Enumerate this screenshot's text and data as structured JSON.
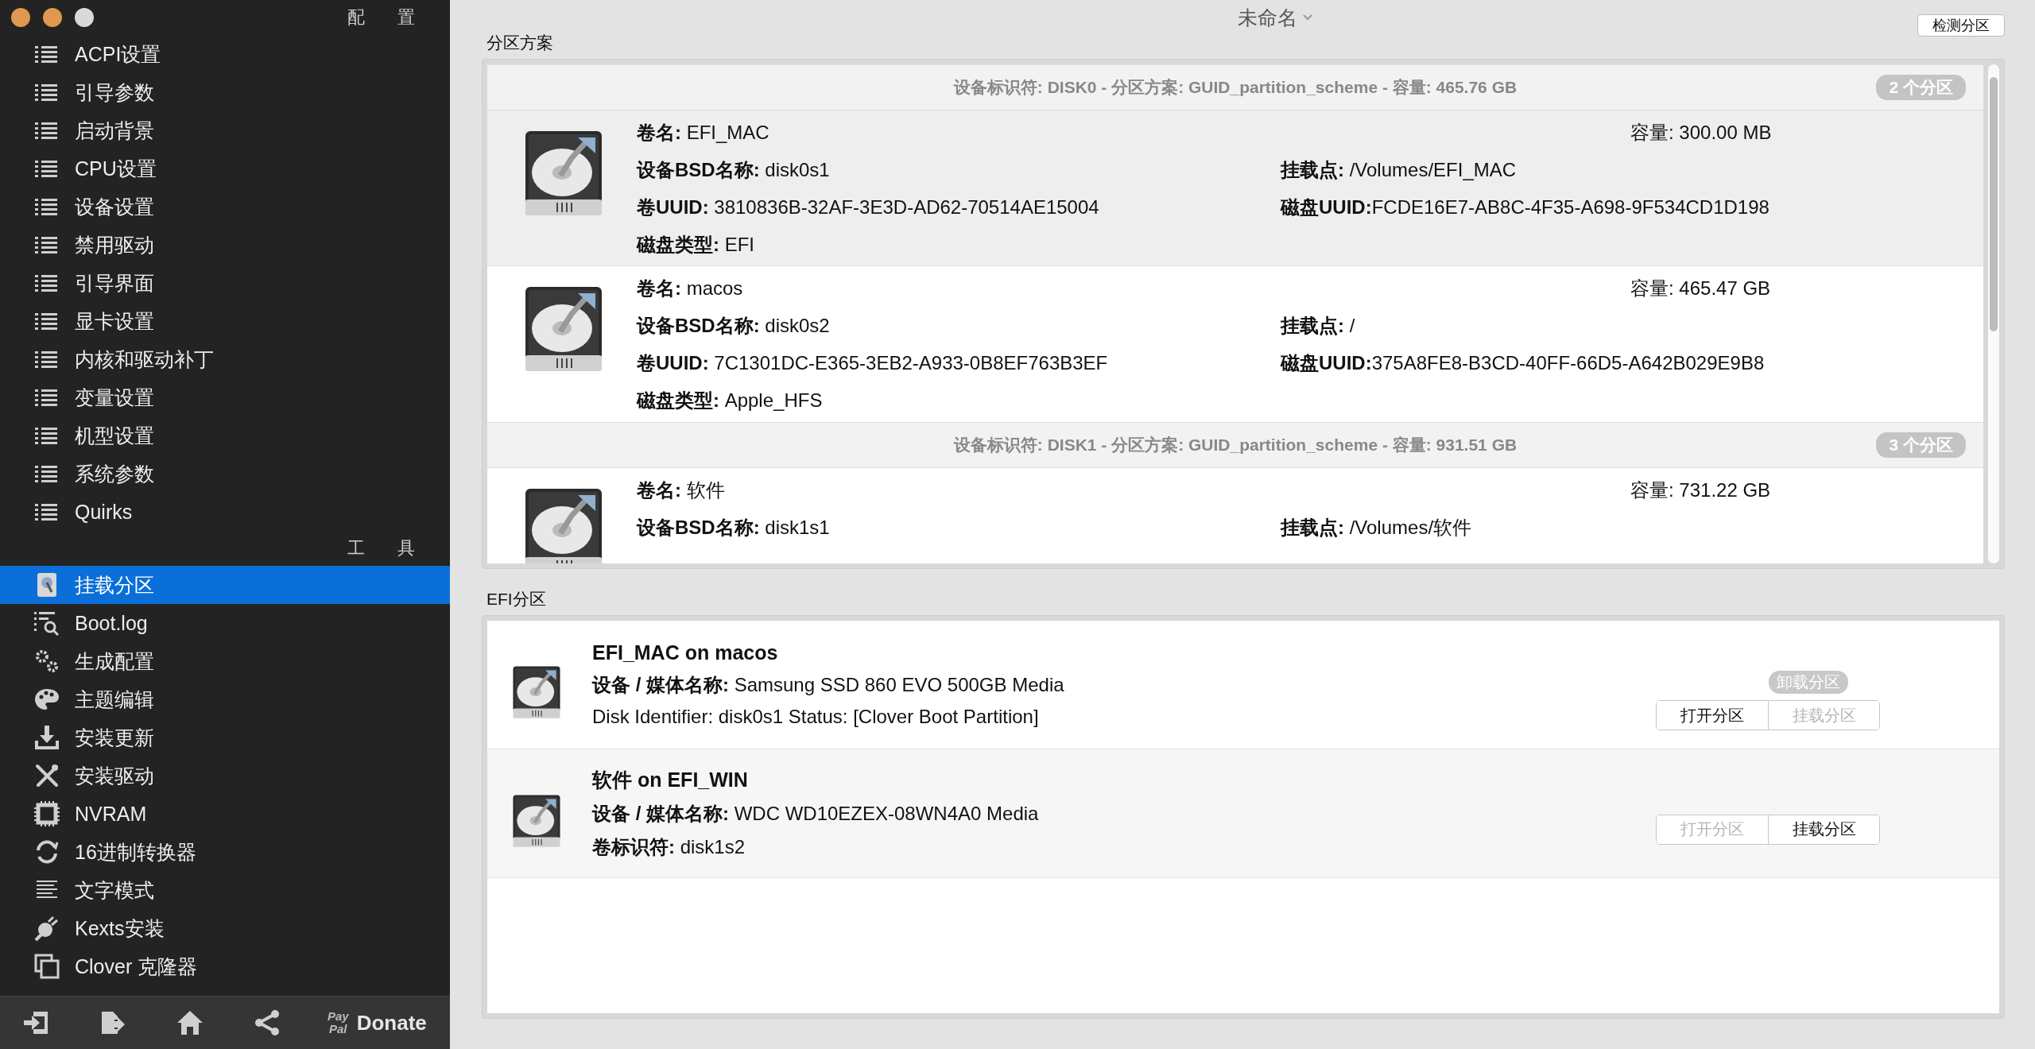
{
  "window": {
    "title": "未命名"
  },
  "sidebar": {
    "sections": [
      {
        "title": "配 置",
        "items": [
          {
            "label": "ACPI设置",
            "selected": false
          },
          {
            "label": "引导参数",
            "selected": false
          },
          {
            "label": "启动背景",
            "selected": false
          },
          {
            "label": "CPU设置",
            "selected": false
          },
          {
            "label": "设备设置",
            "selected": false
          },
          {
            "label": "禁用驱动",
            "selected": false
          },
          {
            "label": "引导界面",
            "selected": false
          },
          {
            "label": "显卡设置",
            "selected": false
          },
          {
            "label": "内核和驱动补丁",
            "selected": false
          },
          {
            "label": "变量设置",
            "selected": false
          },
          {
            "label": "机型设置",
            "selected": false
          },
          {
            "label": "系统参数",
            "selected": false
          },
          {
            "label": "Quirks",
            "selected": false
          }
        ]
      },
      {
        "title": "工 具",
        "items": [
          {
            "label": "挂载分区",
            "selected": true
          },
          {
            "label": "Boot.log",
            "selected": false
          },
          {
            "label": "生成配置",
            "selected": false
          },
          {
            "label": "主题编辑",
            "selected": false
          },
          {
            "label": "安装更新",
            "selected": false
          },
          {
            "label": "安装驱动",
            "selected": false
          },
          {
            "label": "NVRAM",
            "selected": false
          },
          {
            "label": "16进制转换器",
            "selected": false
          },
          {
            "label": "文字模式",
            "selected": false
          },
          {
            "label": "Kexts安装",
            "selected": false
          },
          {
            "label": "Clover 克隆器",
            "selected": false
          }
        ]
      }
    ],
    "footer": {
      "paypal": [
        "Pay",
        "Pal"
      ],
      "donate": "Donate"
    }
  },
  "partition_scheme": {
    "title": "分区方案",
    "detect_button": "检测分区",
    "disks": [
      {
        "header": "设备标识符: DISK0 - 分区方案: GUID_partition_scheme - 容量: 465.76 GB",
        "badge": "2 个分区",
        "partitions": [
          {
            "selected": true,
            "name": "**卷名:** EFI_MAC",
            "capacity": "容量:  300.00 MB",
            "bsd": "**设备BSD名称:** disk0s1",
            "mount": "**挂载点:** /Volumes/EFI_MAC",
            "volume_uuid": "**卷UUID:** 3810836B-32AF-3E3D-AD62-70514AE15004",
            "disk_uuid": "**磁盘UUID:**FCDE16E7-AB8C-4F35-A698-9F534CD1D198",
            "type": "**磁盘类型:** EFI"
          },
          {
            "selected": false,
            "name": "**卷名:** macos",
            "capacity": "容量:  465.47 GB",
            "bsd": "**设备BSD名称:** disk0s2",
            "mount": "**挂载点:** /",
            "volume_uuid": "**卷UUID:** 7C1301DC-E365-3EB2-A933-0B8EF763B3EF",
            "disk_uuid": "**磁盘UUID:**375A8FE8-B3CD-40FF-66D5-A642B029E9B8",
            "type": "**磁盘类型:** Apple_HFS"
          }
        ]
      },
      {
        "header": "设备标识符: DISK1 - 分区方案: GUID_partition_scheme - 容量: 931.51 GB",
        "badge": "3 个分区",
        "partitions": [
          {
            "selected": false,
            "name": "**卷名:** 软件",
            "capacity": "容量:  731.22 GB",
            "bsd": "**设备BSD名称:** disk1s1",
            "mount": "**挂载点:** /Volumes/软件"
          }
        ]
      }
    ]
  },
  "efi": {
    "title": "EFI分区",
    "items": [
      {
        "title": "EFI_MAC on macos",
        "line_1": "**设备 / 媒体名称:** Samsung SSD 860 EVO 500GB Media",
        "line_2": "Disk Identifier: disk0s1 Status: [Clover Boot Partition]",
        "badge": "卸载分区",
        "buttons": [
          {
            "label": "打开分区",
            "disabled": false
          },
          {
            "label": "挂载分区",
            "disabled": true
          }
        ]
      },
      {
        "title": "软件 on EFI_WIN",
        "line_1": "**设备 / 媒体名称:** WDC WD10EZEX-08WN4A0 Media",
        "line_2": "**卷标识符:** disk1s2",
        "buttons": [
          {
            "label": "打开分区",
            "disabled": true
          },
          {
            "label": "挂载分区",
            "disabled": false
          }
        ]
      }
    ]
  }
}
